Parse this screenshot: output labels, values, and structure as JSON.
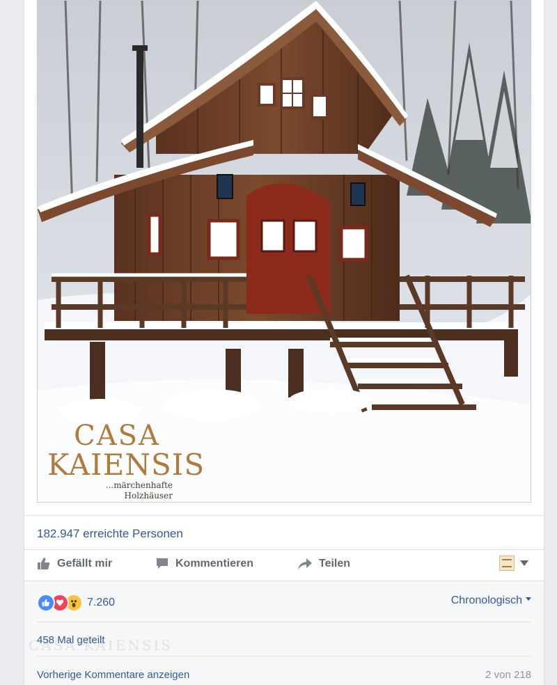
{
  "post": {
    "logo": {
      "line1": "CASA",
      "line2": "KAIENSIS",
      "tagline1": "...märchenhafte",
      "tagline2": "Holzhäuser"
    },
    "reach_text": "182.947 erreichte Personen"
  },
  "actions": {
    "like": "Gefällt mir",
    "comment": "Kommentieren",
    "share": "Teilen"
  },
  "feedback": {
    "reactions": [
      "like",
      "love",
      "wow"
    ],
    "reaction_count": "7.260",
    "sort_label": "Chronologisch",
    "shares_text": "458 Mal geteilt",
    "watermark": "CASA KAIENSIS",
    "prev_comments": "Vorherige Kommentare anzeigen",
    "comment_pager": "2 von 218"
  },
  "colors": {
    "link": "#365899",
    "action_text": "#606770",
    "background": "#e9ebee"
  },
  "icons": {
    "like": "thumbs-up-icon",
    "comment": "speech-bubble-icon",
    "share": "share-arrow-icon"
  }
}
